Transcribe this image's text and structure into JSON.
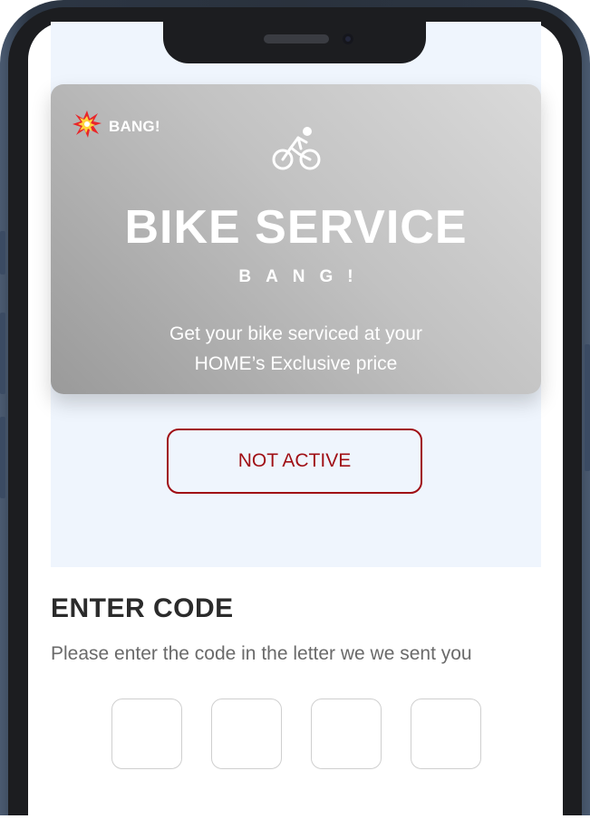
{
  "promo": {
    "badge_icon": "collision-icon",
    "badge_label": "BANG!",
    "icon": "cyclist-icon",
    "title": "BIKE SERVICE",
    "subtitle": "BANG!",
    "description_line1": "Get your bike serviced at your",
    "description_line2": "HOME’s Exclusive price",
    "status_label": "NOT ACTIVE"
  },
  "code_entry": {
    "title": "ENTER CODE",
    "instruction": "Please enter the code in the letter we we sent you",
    "digits": [
      "",
      "",
      "",
      ""
    ]
  },
  "colors": {
    "accent": "#a00f15",
    "hero_background": "#eff5fd",
    "heading_text": "#2b2b2b",
    "muted_text": "#6a6a6a"
  }
}
